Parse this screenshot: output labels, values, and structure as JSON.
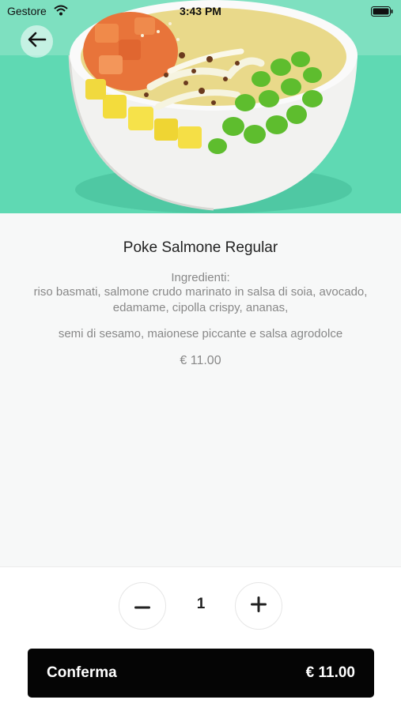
{
  "status_bar": {
    "carrier": "Gestore",
    "time": "3:43 PM"
  },
  "hero": {
    "image_description_icon": "poke-bowl-image",
    "background_color": "#5fd9b3"
  },
  "product": {
    "title": "Poke Salmone Regular",
    "ingredients_label": "Ingredienti:",
    "ingredients_line": "riso basmati, salmone crudo marinato in salsa di soia, avocado, edamame, cipolla crispy, ananas,",
    "ingredients_extra": "semi di sesamo, maionese piccante e salsa agrodolce",
    "price": "€ 11.00"
  },
  "order": {
    "quantity": "1",
    "confirm_label": "Conferma",
    "confirm_price": "€ 11.00"
  }
}
